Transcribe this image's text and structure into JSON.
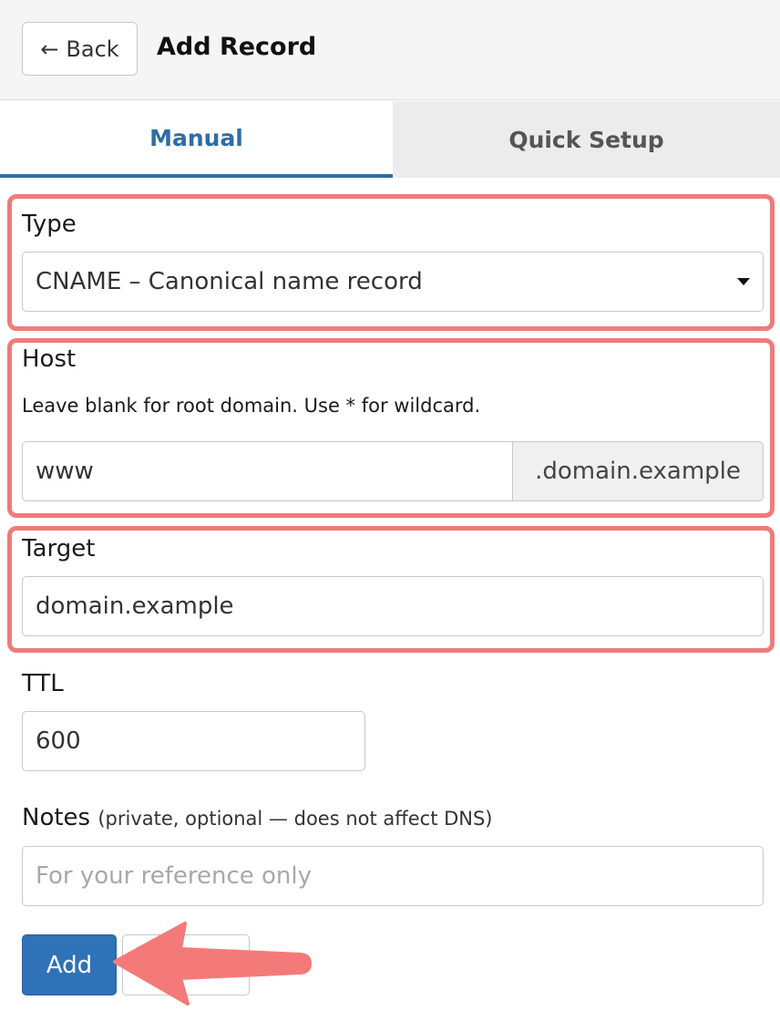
{
  "header": {
    "back_label": "Back",
    "title": "Add Record"
  },
  "tabs": [
    {
      "label": "Manual",
      "active": true
    },
    {
      "label": "Quick Setup",
      "active": false
    }
  ],
  "form": {
    "type": {
      "label": "Type",
      "value": "CNAME – Canonical name record"
    },
    "host": {
      "label": "Host",
      "help": "Leave blank for root domain. Use * for wildcard.",
      "value": "www",
      "suffix": ".domain.example"
    },
    "target": {
      "label": "Target",
      "value": "domain.example"
    },
    "ttl": {
      "label": "TTL",
      "value": "600"
    },
    "notes": {
      "label": "Notes",
      "sublabel": "(private, optional — does not affect DNS)",
      "placeholder": "For your reference only"
    }
  },
  "actions": {
    "add_label": "Add"
  },
  "colors": {
    "accent": "#2e6da4",
    "highlight": "#f07b7b",
    "primary_button": "#2f72b8"
  },
  "icons": {
    "back": "arrow-left-icon",
    "dropdown": "caret-down-icon",
    "pointer": "arrow-pointer-icon"
  }
}
